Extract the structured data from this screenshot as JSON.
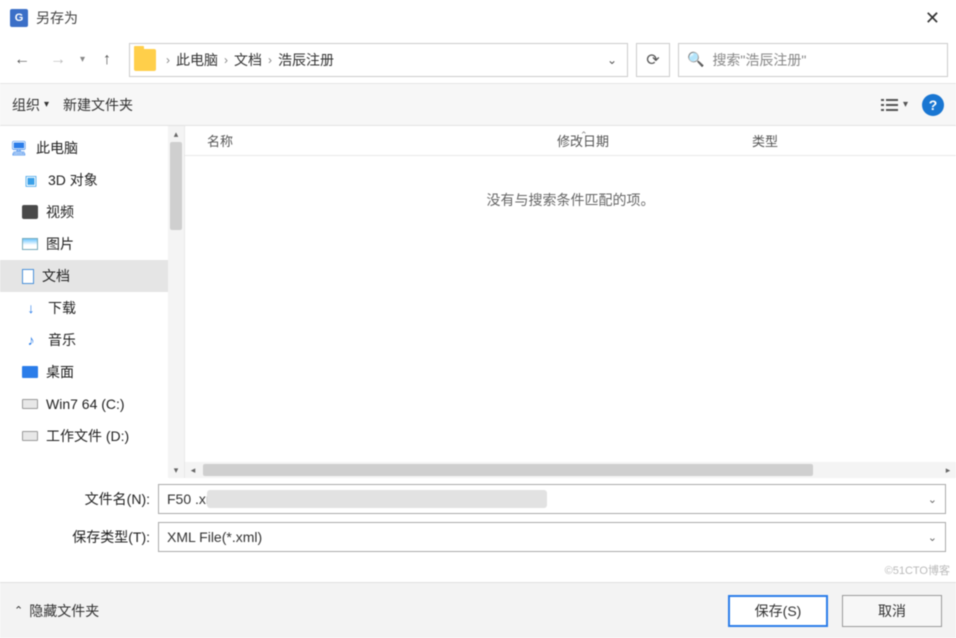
{
  "title": "另存为",
  "breadcrumbs": [
    "此电脑",
    "文档",
    "浩辰注册"
  ],
  "search_placeholder": "搜索\"浩辰注册\"",
  "toolbar": {
    "organize": "组织",
    "new_folder": "新建文件夹"
  },
  "columns": {
    "name": "名称",
    "date": "修改日期",
    "type": "类型"
  },
  "empty_msg": "没有与搜索条件匹配的项。",
  "tree": [
    {
      "label": "此电脑",
      "icon": "pc",
      "root": true
    },
    {
      "label": "3D 对象",
      "icon": "cube"
    },
    {
      "label": "视频",
      "icon": "video"
    },
    {
      "label": "图片",
      "icon": "img"
    },
    {
      "label": "文档",
      "icon": "doc",
      "selected": true
    },
    {
      "label": "下载",
      "icon": "dl"
    },
    {
      "label": "音乐",
      "icon": "music"
    },
    {
      "label": "桌面",
      "icon": "desk"
    },
    {
      "label": "Win7 64 (C:)",
      "icon": "drive"
    },
    {
      "label": "工作文件 (D:)",
      "icon": "drive"
    }
  ],
  "filename_label": "文件名(N):",
  "filename_value": "F50                                      .xml",
  "filetype_label": "保存类型(T):",
  "filetype_value": "XML File(*.xml)",
  "hide_folders": "隐藏文件夹",
  "save_btn": "保存(S)",
  "cancel_btn": "取消",
  "watermark": "©51CTO博客"
}
